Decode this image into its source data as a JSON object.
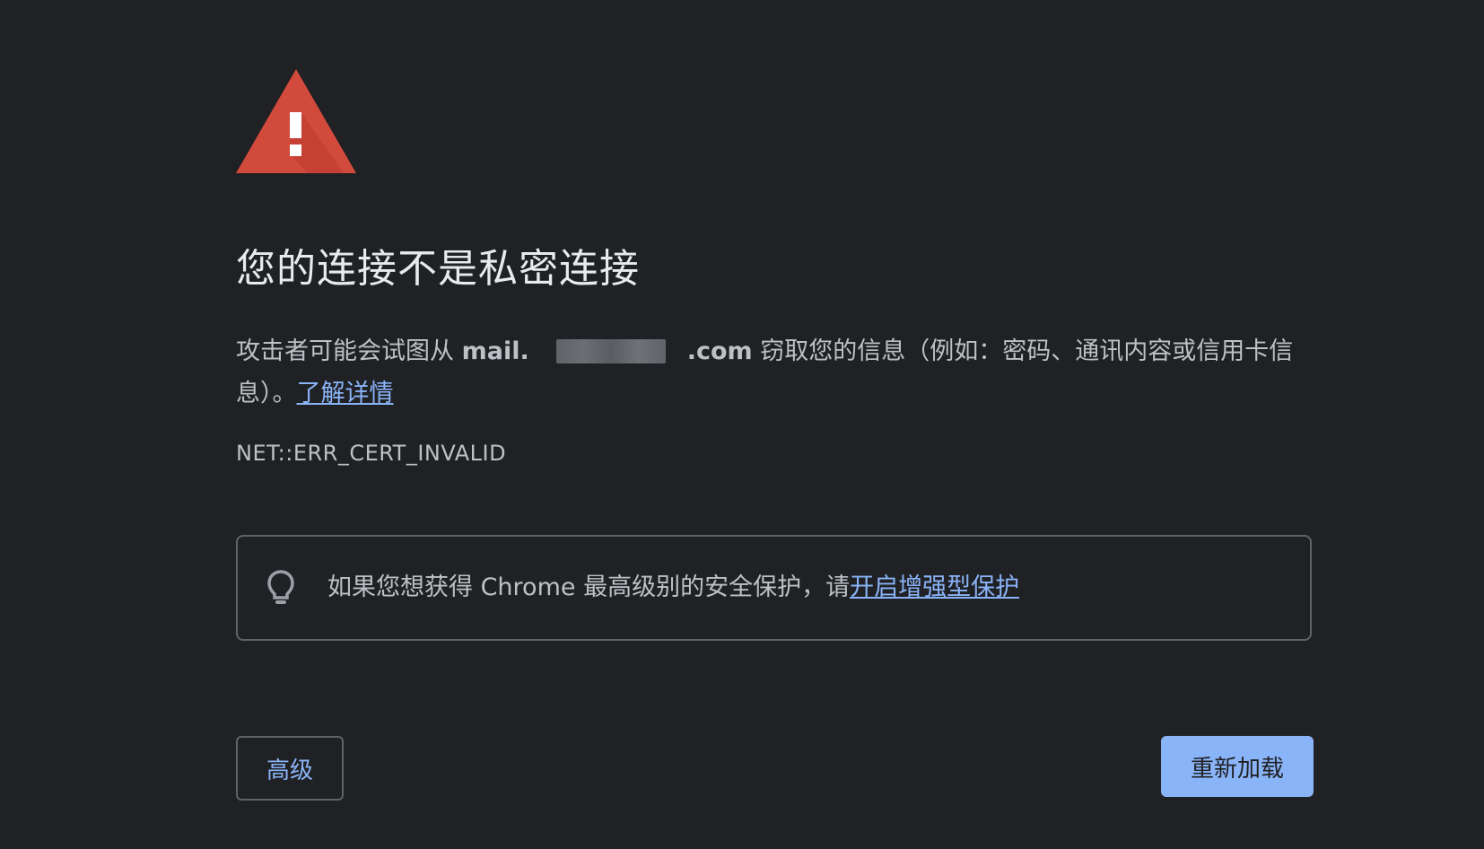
{
  "interstitial": {
    "icon": "warning-triangle-icon",
    "title": "您的连接不是私密连接",
    "body": {
      "prefix": "攻击者可能会试图从",
      "host_start": "mail.",
      "host_end": ".com",
      "suffix": "窃取您的信息（例如：密码、通讯内容或信用卡信息）。",
      "learn_more_link": "了解详情"
    },
    "error_code": "NET::ERR_CERT_INVALID",
    "tip": {
      "icon": "lightbulb-icon",
      "text": "如果您想获得 Chrome 最高级别的安全保护，请",
      "link": "开启增强型保护"
    },
    "buttons": {
      "advanced": "高级",
      "reload": "重新加载"
    }
  },
  "colors": {
    "background": "#202124",
    "title": "#e8eaed",
    "text": "#bdc1c6",
    "link": "#8ab4f8",
    "warning": "#d93025",
    "primary_button": "#8ab4f8",
    "border": "#5f6368"
  }
}
